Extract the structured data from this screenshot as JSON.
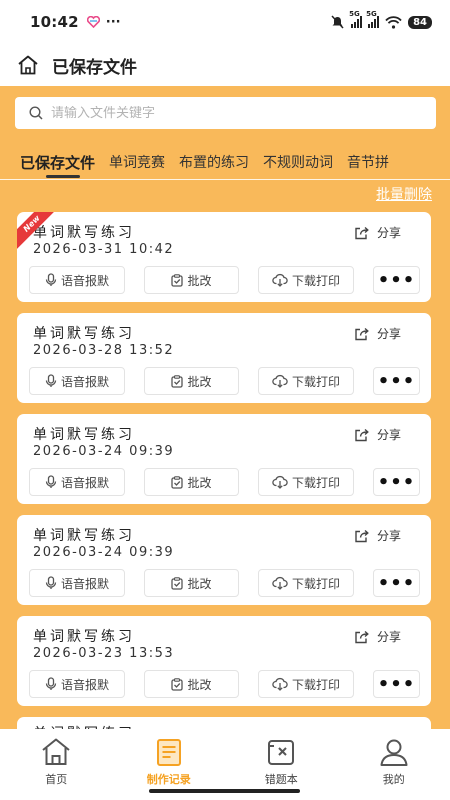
{
  "status_bar": {
    "time": "10:42",
    "dots": "···",
    "network1": "5G",
    "network2": "5G",
    "battery": "84"
  },
  "header": {
    "title": "已保存文件"
  },
  "search": {
    "placeholder": "请输入文件关键字"
  },
  "tabs": [
    {
      "label": "已保存文件",
      "active": true
    },
    {
      "label": "单词竞赛"
    },
    {
      "label": "布置的练习"
    },
    {
      "label": "不规则动词"
    },
    {
      "label": "音节拼"
    }
  ],
  "batch_delete_label": "批量删除",
  "card_labels": {
    "share": "分享",
    "voice": "语音报默",
    "grade": "批改",
    "download": "下载打印",
    "more": "•••",
    "new_badge": "New"
  },
  "cards": [
    {
      "title": "单词默写练习",
      "date": "2026-03-31 10:42",
      "is_new": true
    },
    {
      "title": "单词默写练习",
      "date": "2026-03-28 13:52"
    },
    {
      "title": "单词默写练习",
      "date": "2026-03-24 09:39"
    },
    {
      "title": "单词默写练习",
      "date": "2026-03-24 09:39"
    },
    {
      "title": "单词默写练习",
      "date": "2026-03-23 13:53"
    }
  ],
  "partial_card_title": "单词默写练习",
  "bottom_nav": [
    {
      "label": "首页",
      "icon": "home-icon"
    },
    {
      "label": "制作记录",
      "icon": "document-icon",
      "active": true
    },
    {
      "label": "错题本",
      "icon": "wrong-book-icon"
    },
    {
      "label": "我的",
      "icon": "user-icon"
    }
  ],
  "colors": {
    "background": "#f9b95a",
    "accent": "#f5a223",
    "new_badge": "#e6393a"
  }
}
